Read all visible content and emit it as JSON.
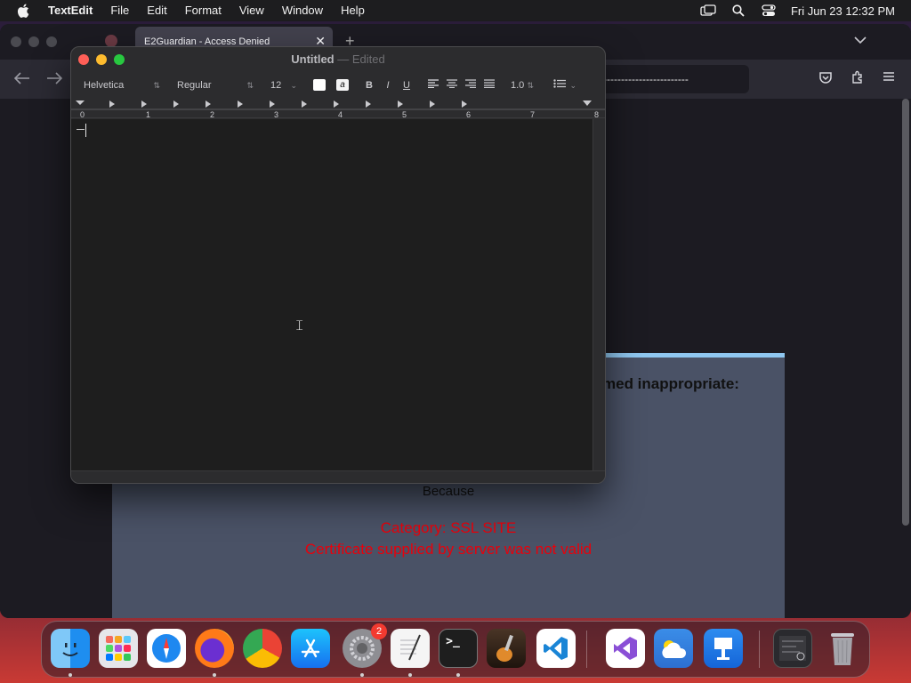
{
  "menubar": {
    "app_name": "TextEdit",
    "items": [
      "File",
      "Edit",
      "Format",
      "View",
      "Window",
      "Help"
    ],
    "clock": "Fri Jun 23  12:32 PM",
    "status_icons": [
      "screen-mirroring-icon",
      "search-icon",
      "control-center-icon"
    ]
  },
  "browser": {
    "tab_title": "E2Guardian - Access Denied",
    "url_text": "------------------------",
    "page": {
      "reason_fragment": "med inappropriate:",
      "because": "Because",
      "category": "Category: SSL SITE",
      "cert_message": "Certificate supplied by server was not valid"
    },
    "accent_color": "#8fc7f0",
    "alert_color": "#e8000b"
  },
  "textedit": {
    "doc_name": "Untitled",
    "title_sep": "—",
    "doc_state": "Edited",
    "font_family": "Helvetica",
    "font_style": "Regular",
    "font_size": "12",
    "bold_label": "B",
    "italic_label": "I",
    "underline_label": "U",
    "bg_color_glyph": "a",
    "line_spacing": "1.0",
    "ruler_labels": [
      "0",
      "1",
      "2",
      "3",
      "4",
      "5",
      "6",
      "7",
      "8"
    ],
    "traffic_colors": [
      "#ff5f57",
      "#febc2e",
      "#28c840"
    ]
  },
  "dock": {
    "apps": [
      {
        "name": "Finder",
        "icon": "finder-icon",
        "running": true
      },
      {
        "name": "Launchpad",
        "icon": "launchpad-icon",
        "running": false
      },
      {
        "name": "Safari",
        "icon": "safari-icon",
        "running": false
      },
      {
        "name": "Firefox",
        "icon": "firefox-icon",
        "running": true
      },
      {
        "name": "Chrome",
        "icon": "chrome-icon",
        "running": false
      },
      {
        "name": "App Store",
        "icon": "app-store-icon",
        "running": false
      },
      {
        "name": "System Settings",
        "icon": "system-settings-icon",
        "running": true,
        "badge": "2"
      },
      {
        "name": "TextEdit",
        "icon": "textedit-icon",
        "running": true
      },
      {
        "name": "Terminal",
        "icon": "terminal-icon",
        "running": true
      },
      {
        "name": "GarageBand",
        "icon": "garageband-icon",
        "running": false
      },
      {
        "name": "Visual Studio Code",
        "icon": "vscode-icon",
        "running": false
      },
      {
        "name": "Visual Studio",
        "icon": "visual-studio-icon",
        "running": false
      },
      {
        "name": "Weather",
        "icon": "weather-icon",
        "running": false
      },
      {
        "name": "Keynote",
        "icon": "keynote-icon",
        "running": false
      },
      {
        "name": "Downloads",
        "icon": "downloads-stack-icon",
        "running": false
      },
      {
        "name": "Trash",
        "icon": "trash-icon",
        "running": false
      }
    ]
  }
}
